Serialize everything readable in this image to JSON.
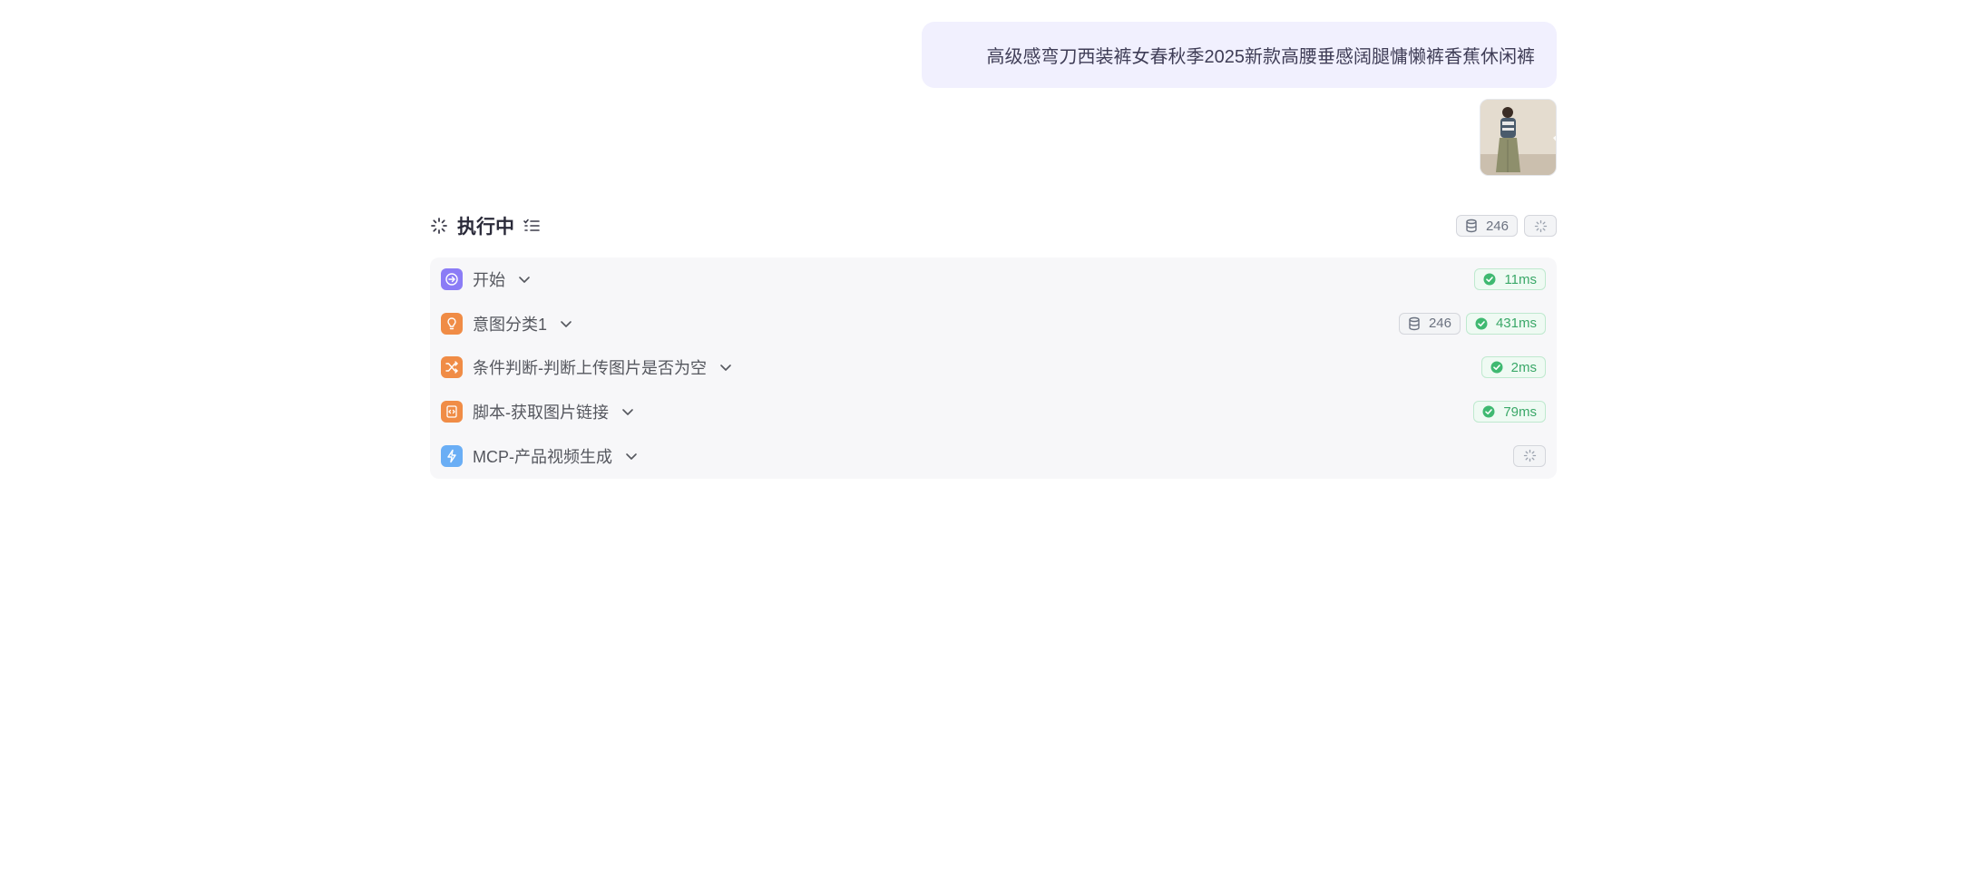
{
  "message": {
    "text": "高级感弯刀西装裤女春秋季2025新款高腰垂感阔腿慵懒裤香蕉休闲裤"
  },
  "status": {
    "title": "执行中",
    "token_count": "246"
  },
  "steps": [
    {
      "label": "开始",
      "icon": "arrow-circle-icon",
      "color": "#8b7cf6",
      "tokens": "",
      "duration": "11ms"
    },
    {
      "label": "意图分类1",
      "icon": "lightbulb-icon",
      "color": "#f08c46",
      "tokens": "246",
      "duration": "431ms"
    },
    {
      "label": "条件判断-判断上传图片是否为空",
      "icon": "shuffle-icon",
      "color": "#f08c46",
      "tokens": "",
      "duration": "2ms"
    },
    {
      "label": "脚本-获取图片链接",
      "icon": "script-icon",
      "color": "#f08c46",
      "tokens": "",
      "duration": "79ms"
    },
    {
      "label": "MCP-产品视频生成",
      "icon": "lightning-icon",
      "color": "#6aaef5",
      "tokens": "",
      "duration": ""
    }
  ]
}
